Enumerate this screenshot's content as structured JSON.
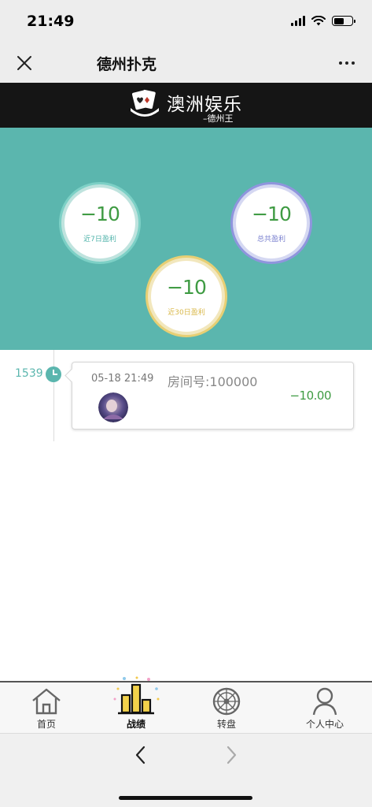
{
  "status_bar": {
    "time": "21:49"
  },
  "nav": {
    "title": "德州扑克"
  },
  "brand": {
    "title": "澳洲娱乐",
    "subtitle": "–德州王"
  },
  "stats": {
    "last7": {
      "value": "−10",
      "label": "近7日盈利"
    },
    "total": {
      "value": "−10",
      "label": "总共盈利"
    },
    "last30": {
      "value": "−10",
      "label": "近30日盈利"
    }
  },
  "records": [
    {
      "id": "1539",
      "time": "05-18 21:49",
      "room": "房间号:100000",
      "amount": "−10.00"
    }
  ],
  "tabs": [
    {
      "label": "首页",
      "icon": "home-icon"
    },
    {
      "label": "战绩",
      "icon": "bar-chart-icon"
    },
    {
      "label": "转盘",
      "icon": "wheel-icon"
    },
    {
      "label": "个人中心",
      "icon": "user-icon"
    }
  ],
  "colors": {
    "teal": "#5bb6ae",
    "profit_green": "#3f9b43",
    "ring_7day": "#7dd0c6",
    "ring_total": "#8f95dd",
    "ring_30day": "#e7cf74"
  }
}
